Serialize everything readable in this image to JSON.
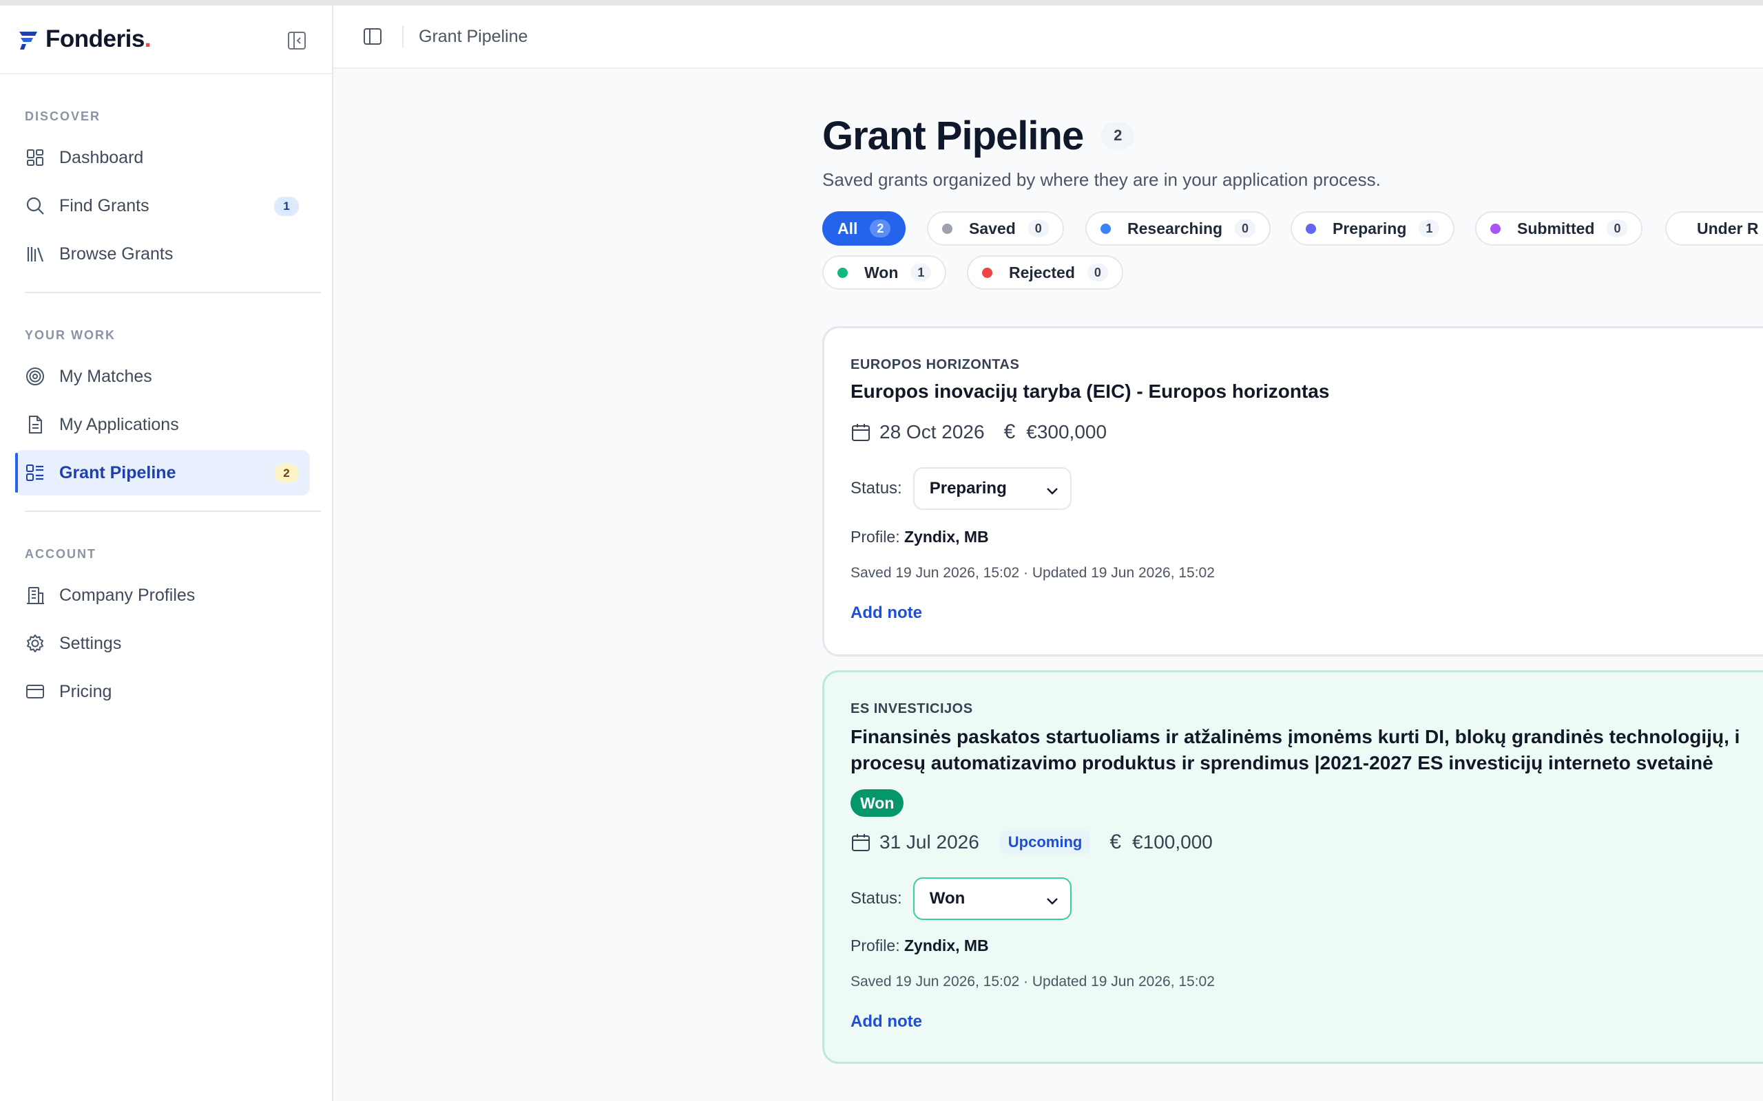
{
  "brand": {
    "name": "Fonderis",
    "dot": "."
  },
  "sidebar": {
    "sections": {
      "discover": "DISCOVER",
      "your_work": "YOUR WORK",
      "account": "ACCOUNT"
    },
    "items": [
      {
        "label": "Dashboard",
        "icon": "dashboard-icon"
      },
      {
        "label": "Find Grants",
        "icon": "search-icon",
        "count": "1"
      },
      {
        "label": "Browse Grants",
        "icon": "library-icon"
      },
      {
        "label": "My Matches",
        "icon": "target-icon"
      },
      {
        "label": "My Applications",
        "icon": "document-icon"
      },
      {
        "label": "Grant Pipeline",
        "icon": "pipeline-icon",
        "count": "2",
        "active": true
      },
      {
        "label": "Company Profiles",
        "icon": "building-icon"
      },
      {
        "label": "Settings",
        "icon": "gear-icon"
      },
      {
        "label": "Pricing",
        "icon": "credit-card-icon"
      }
    ]
  },
  "topbar": {
    "breadcrumb": "Grant Pipeline"
  },
  "page": {
    "title": "Grant Pipeline",
    "count": "2",
    "subtitle": "Saved grants organized by where they are in your application process."
  },
  "filters": [
    {
      "label": "All",
      "count": "2",
      "active": true
    },
    {
      "label": "Saved",
      "count": "0",
      "color": "#9ca3af"
    },
    {
      "label": "Researching",
      "count": "0",
      "color": "#3b82f6"
    },
    {
      "label": "Preparing",
      "count": "1",
      "color": "#6366f1"
    },
    {
      "label": "Submitted",
      "count": "0",
      "color": "#a855f7"
    },
    {
      "label": "Under R",
      "color": "#f59e0b"
    },
    {
      "label": "Won",
      "count": "1",
      "color": "#10b981"
    },
    {
      "label": "Rejected",
      "count": "0",
      "color": "#ef4444"
    }
  ],
  "cards": [
    {
      "category": "EUROPOS HORIZONTAS",
      "title": "Europos inovacijų taryba (EIC) - Europos horizontas",
      "date": "28 Oct 2026",
      "amount": "€300,000",
      "status_label": "Status:",
      "status": "Preparing",
      "profile_label": "Profile:",
      "profile": "Zyndix, MB",
      "stamps": "Saved 19 Jun 2026, 15:02 · Updated 19 Jun 2026, 15:02",
      "add_note": "Add note"
    },
    {
      "category": "ES INVESTICIJOS",
      "title_line1": "Finansinės paskatos startuoliams ir atžalinėms įmonėms kurti DI, blokų grandinės technologijų, i",
      "title_line2": "procesų automatizavimo produktus ir sprendimus |2021-2027 ES investicijų interneto svetainė",
      "badge": "Won",
      "date": "31 Jul 2026",
      "date_tag": "Upcoming",
      "amount": "€100,000",
      "status_label": "Status:",
      "status": "Won",
      "profile_label": "Profile:",
      "profile": "Zyndix, MB",
      "stamps": "Saved 19 Jun 2026, 15:02 · Updated 19 Jun 2026, 15:02",
      "add_note": "Add note"
    }
  ],
  "colors": {
    "accent": "#2563eb",
    "won": "#059669"
  },
  "euro_symbol": "€"
}
